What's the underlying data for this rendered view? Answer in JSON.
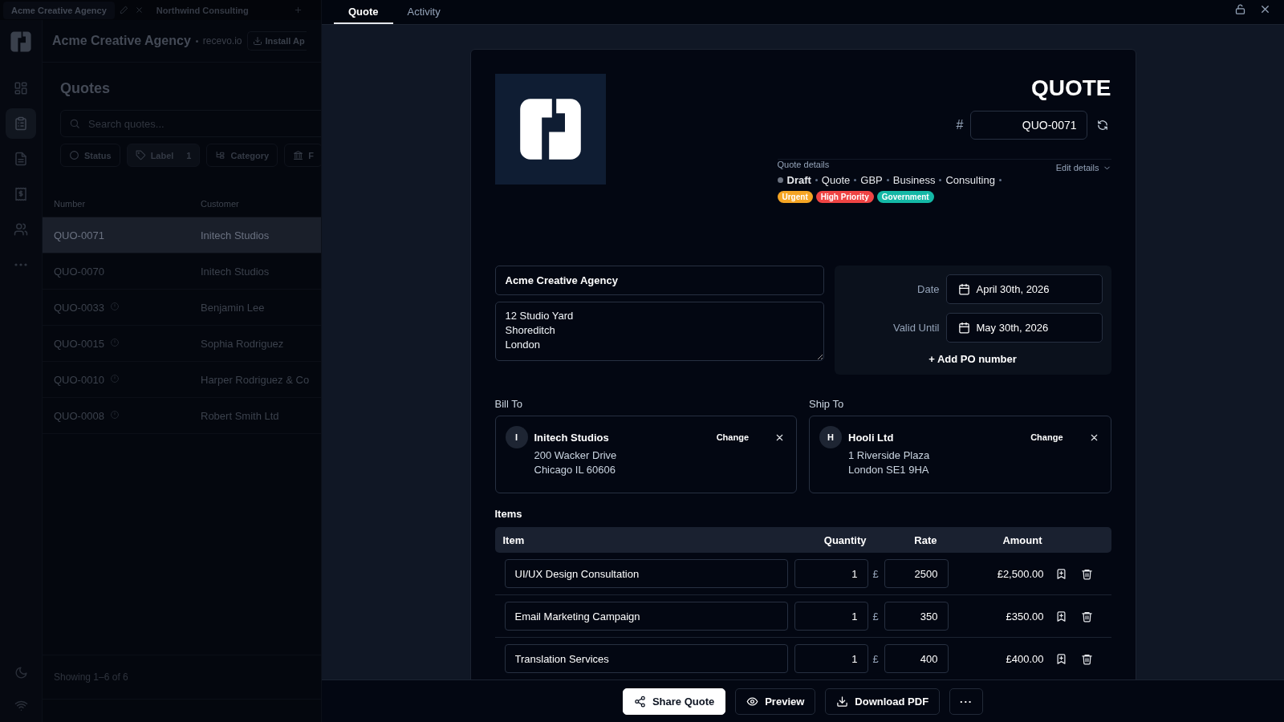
{
  "background": {
    "window_tabs": [
      {
        "label": "Acme Creative Agency",
        "selected": true
      },
      {
        "label": "Northwind Consulting",
        "selected": false
      }
    ],
    "rail": [
      {
        "kind": "dashboard",
        "selected": false
      },
      {
        "kind": "quotes",
        "selected": true
      },
      {
        "kind": "document",
        "selected": false
      },
      {
        "kind": "receipt",
        "selected": false
      },
      {
        "kind": "people",
        "selected": false
      },
      {
        "kind": "more",
        "selected": false
      }
    ],
    "org_name": "Acme Creative Agency",
    "domain": "recevo.io",
    "install_button": "Install Ap",
    "page_title": "Quotes",
    "search": {
      "placeholder": "Search quotes..."
    },
    "filters": [
      {
        "kind": "status",
        "label": "Status"
      },
      {
        "kind": "label",
        "label": "Label",
        "count": "1"
      },
      {
        "kind": "category",
        "label": "Category"
      },
      {
        "kind": "bank",
        "label": "F"
      }
    ],
    "table": {
      "columns": [
        "Number",
        "Customer"
      ],
      "rows": [
        {
          "number": "QUO-0071",
          "customer": "Initech Studios",
          "flagged": false,
          "selected": true
        },
        {
          "number": "QUO-0070",
          "customer": "Initech Studios",
          "flagged": false,
          "selected": false
        },
        {
          "number": "QUO-0033",
          "customer": "Benjamin Lee",
          "flagged": true,
          "selected": false
        },
        {
          "number": "QUO-0015",
          "customer": "Sophia Rodriguez",
          "flagged": true,
          "selected": false
        },
        {
          "number": "QUO-0010",
          "customer": "Harper Rodriguez & Co",
          "flagged": true,
          "selected": false
        },
        {
          "number": "QUO-0008",
          "customer": "Robert Smith Ltd",
          "flagged": true,
          "selected": false
        }
      ]
    },
    "footer": "Showing 1–6 of 6"
  },
  "drawer": {
    "tabs": [
      {
        "label": "Quote",
        "selected": true
      },
      {
        "label": "Activity",
        "selected": false
      }
    ],
    "document": {
      "title": "QUOTE",
      "number_prefix": "#",
      "number": "QUO-0071",
      "details_label": "Quote details",
      "status": "Draft",
      "meta": [
        "Quote",
        "GBP",
        "Business",
        "Consulting"
      ],
      "tags": [
        {
          "label": "Urgent",
          "color": "#f5a524"
        },
        {
          "label": "High Priority",
          "color": "#ef4444"
        },
        {
          "label": "Government",
          "color": "#14b8a6"
        }
      ],
      "edit_details": "Edit details",
      "from_name": "Acme Creative Agency",
      "from_address": "12 Studio Yard\nShoreditch\nLondon",
      "dates": [
        {
          "label": "Date",
          "value": "April 30th, 2026"
        },
        {
          "label": "Valid Until",
          "value": "May 30th, 2026"
        }
      ],
      "add_po": "+ Add PO number",
      "parties": [
        {
          "heading": "Bill To",
          "initial": "I",
          "name": "Initech Studios",
          "lines": [
            "200 Wacker Drive",
            "Chicago IL 60606"
          ],
          "change": "Change"
        },
        {
          "heading": "Ship To",
          "initial": "H",
          "name": "Hooli Ltd",
          "lines": [
            "1 Riverside Plaza",
            "London SE1 9HA"
          ],
          "change": "Change"
        }
      ],
      "items_label": "Items",
      "item_columns": [
        "Item",
        "Quantity",
        "Rate",
        "Amount"
      ],
      "items": [
        {
          "item": "UI/UX Design Consultation",
          "quantity": "1",
          "currency": "£",
          "rate": "2500",
          "amount": "£2,500.00"
        },
        {
          "item": "Email Marketing Campaign",
          "quantity": "1",
          "currency": "£",
          "rate": "350",
          "amount": "£350.00"
        },
        {
          "item": "Translation Services",
          "quantity": "1",
          "currency": "£",
          "rate": "400",
          "amount": "£400.00"
        }
      ]
    },
    "actions": [
      {
        "kind": "share",
        "label": "Share Quote"
      },
      {
        "kind": "preview",
        "label": "Preview"
      },
      {
        "kind": "download",
        "label": "Download PDF"
      },
      {
        "kind": "more",
        "label": "···"
      }
    ]
  }
}
